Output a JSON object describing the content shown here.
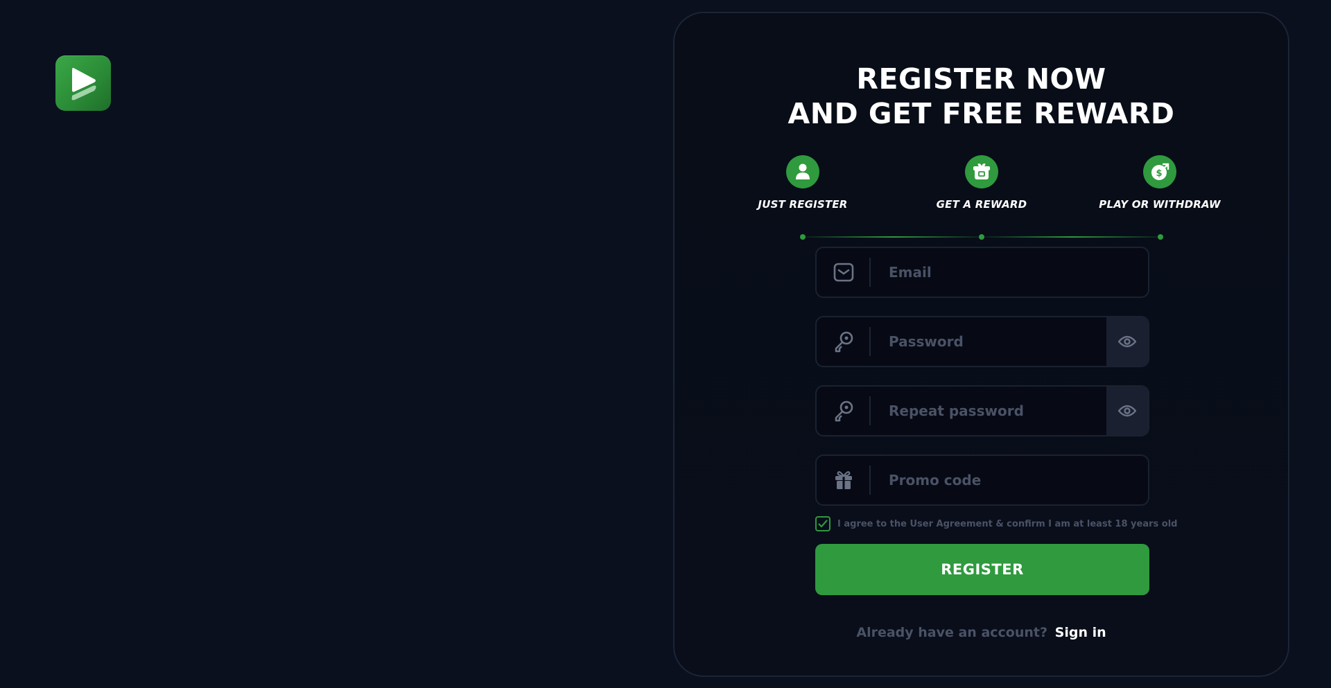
{
  "brand": {
    "logo_icon": "play-logo-icon",
    "accent": "#2f9a3e",
    "background": "#0a101e"
  },
  "headline": {
    "line1": "REGISTER NOW",
    "line2": "AND GET FREE REWARD"
  },
  "steps": [
    {
      "label": "JUST REGISTER",
      "icon": "user-icon"
    },
    {
      "label": "GET A REWARD",
      "icon": "gift-box-icon"
    },
    {
      "label": "PLAY OR WITHDRAW",
      "icon": "money-bag-icon"
    }
  ],
  "form": {
    "email": {
      "placeholder": "Email",
      "value": "",
      "icon": "mail-icon"
    },
    "password": {
      "placeholder": "Password",
      "value": "",
      "icon": "key-icon",
      "toggle_icon": "eye-icon"
    },
    "repeat_password": {
      "placeholder": "Repeat password",
      "value": "",
      "icon": "key-icon",
      "toggle_icon": "eye-icon"
    },
    "promo": {
      "placeholder": "Promo code",
      "value": "",
      "icon": "gift-icon"
    },
    "agree": {
      "checked": true,
      "text": "I agree to the User Agreement & confirm I am at least 18 years old"
    },
    "register_label": "REGISTER"
  },
  "signin": {
    "prompt": "Already have an account?",
    "link_label": "Sign in"
  }
}
